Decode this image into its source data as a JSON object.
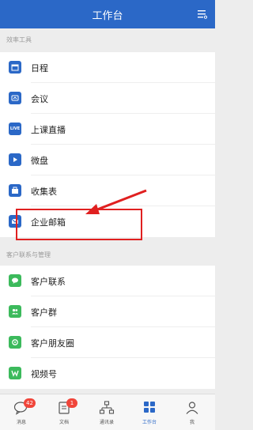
{
  "header": {
    "title": "工作台"
  },
  "sections": [
    {
      "title": "效率工具",
      "items": [
        {
          "label": "日程",
          "icon": "calendar-icon"
        },
        {
          "label": "会议",
          "icon": "meeting-icon"
        },
        {
          "label": "上课直播",
          "icon": "live-icon",
          "icon_text": "LIVE"
        },
        {
          "label": "微盘",
          "icon": "cloud-drive-icon"
        },
        {
          "label": "收集表",
          "icon": "form-icon"
        },
        {
          "label": "企业邮箱",
          "icon": "mail-icon"
        }
      ]
    },
    {
      "title": "客户联系与管理",
      "items": [
        {
          "label": "客户联系",
          "icon": "chat-icon"
        },
        {
          "label": "客户群",
          "icon": "group-icon"
        },
        {
          "label": "客户朋友圈",
          "icon": "moments-icon"
        },
        {
          "label": "视频号",
          "icon": "video-channel-icon"
        }
      ]
    }
  ],
  "tabs": [
    {
      "label": "消息",
      "badge": "42"
    },
    {
      "label": "文档",
      "badge": "1"
    },
    {
      "label": "通讯录"
    },
    {
      "label": "工作台",
      "active": true
    },
    {
      "label": "我"
    }
  ],
  "colors": {
    "primary": "#2b68c7",
    "green": "#3cba5c",
    "highlight": "#e02020",
    "badge": "#f0453a"
  }
}
